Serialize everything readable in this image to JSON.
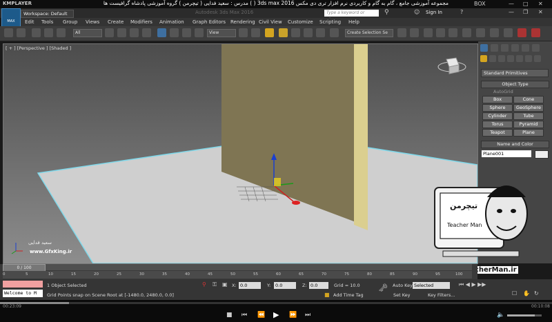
{
  "player": {
    "logo": "KMPLAYER",
    "course_title": "مجموعه آموزشی جامع ، گام به گام و کاربردی نرم افزار تری دی مکس 3ds max 2016 ( ) مدرس : سعید فدایی ( تیچرمن ) گروه آموزشی پادشاه گرافیست ها",
    "sys_label": "BOX",
    "elapsed": "00:23:09",
    "total": "00:10:08"
  },
  "max": {
    "logo_text": "MAX",
    "workspace": "Workspace: Default",
    "version_watermark": "Autodesk 3ds Max 2016",
    "search_placeholder": "Type a keyword or phrase",
    "signin": "Sign In"
  },
  "menu": [
    "Edit",
    "Tools",
    "Group",
    "Views",
    "Create",
    "Modifiers",
    "Animation",
    "Graph Editors",
    "Rendering",
    "Civil View",
    "Customize",
    "Scripting",
    "Help"
  ],
  "toolbar": {
    "filter": "All",
    "ref_coord": "View",
    "selection_set": "Create Selection Se"
  },
  "viewport": {
    "label": "[ + ] [Perspective ] [Shaded ]",
    "watermark_name": "سعید فدایی",
    "watermark_site": "www.GfxKing.ir"
  },
  "command_panel": {
    "category": "Standard Primitives",
    "object_type_head": "Object Type",
    "autogrid": "AutoGrid",
    "buttons": [
      "Box",
      "Cone",
      "Sphere",
      "GeoSphere",
      "Cylinder",
      "Tube",
      "Torus",
      "Pyramid",
      "Teapot",
      "Plane"
    ],
    "name_color_head": "Name and Color",
    "object_name": "Plane001"
  },
  "badge": {
    "persian_title": "تیچرمن",
    "name": "Teacher Man",
    "url": "www.TeacherMan.ir"
  },
  "timeline": {
    "frame": "0 / 100",
    "ticks": [
      "0",
      "5",
      "10",
      "15",
      "20",
      "25",
      "30",
      "35",
      "40",
      "45",
      "50",
      "55",
      "60",
      "65",
      "70",
      "75",
      "80",
      "85",
      "90",
      "95",
      "100"
    ]
  },
  "status": {
    "maxscript": "Welcome to M",
    "selected": "1 Object Selected",
    "prompt": "Grid Points snap on Scene Root at [-1480.0, 2480.0, 0.0]",
    "x_label": "X:",
    "x": "0.0",
    "y_label": "Y:",
    "y": "0.0",
    "z_label": "Z:",
    "z": "0.0",
    "grid": "Grid = 10.0",
    "add_time_tag": "Add Time Tag",
    "auto_key": "Auto Key",
    "set_key": "Set Key",
    "key_mode": "Selected",
    "key_filters": "Key Filters..."
  }
}
